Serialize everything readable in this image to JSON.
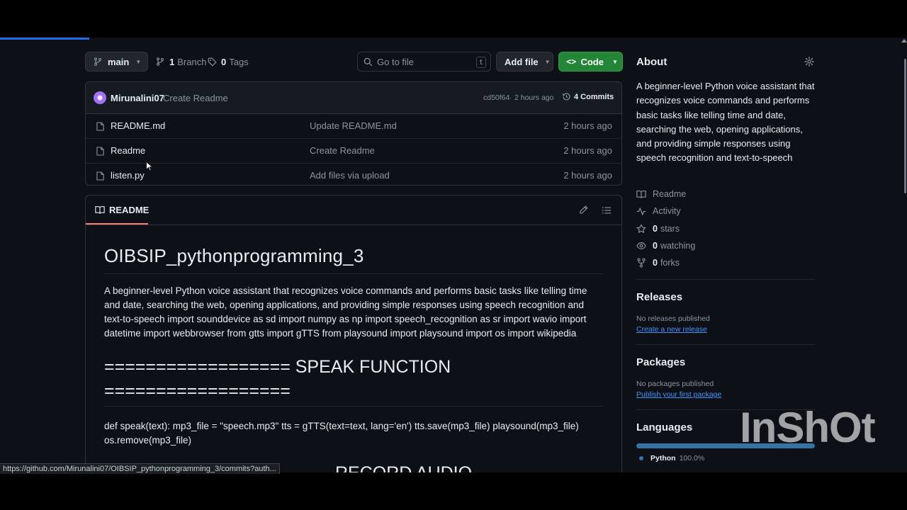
{
  "toolbar": {
    "branch_button": "main",
    "branches_count": "1",
    "branches_label": "Branch",
    "tags_count": "0",
    "tags_label": "Tags",
    "go_to_file_placeholder": "Go to file",
    "go_to_file_shortcut": "t",
    "add_file_label": "Add file",
    "code_label": "Code"
  },
  "latest_commit": {
    "author": "Mirunalini07",
    "message": "Create Readme",
    "hash": "cd50f64",
    "separator": "·",
    "time": "2 hours ago",
    "commits_count": "4 Commits"
  },
  "files": [
    {
      "name": "README.md",
      "message": "Update README.md",
      "time": "2 hours ago"
    },
    {
      "name": "Readme",
      "message": "Create Readme",
      "time": "2 hours ago"
    },
    {
      "name": "listen.py",
      "message": "Add files via upload",
      "time": "2 hours ago"
    }
  ],
  "readme": {
    "tab_label": "README",
    "title": "OIBSIP_pythonprogramming_3",
    "paragraph": "A beginner-level Python voice assistant that recognizes voice commands and performs basic tasks like telling time and date, searching the web, opening applications, and providing simple responses using speech recognition and text-to-speech import sounddevice as sd import numpy as np import speech_recognition as sr import wavio import datetime import webbrowser from gtts import gTTS from playsound import playsound import os import wikipedia",
    "heading_speak_line1": "================== SPEAK FUNCTION",
    "heading_speak_line2": "==================",
    "code_paragraph": "def speak(text): mp3_file = \"speech.mp3\" tts = gTTS(text=text, lang='en') tts.save(mp3_file) playsound(mp3_file) os.remove(mp3_file)",
    "heading_record_partial": "RECORD AUDIO"
  },
  "about": {
    "heading": "About",
    "description": "A beginner-level Python voice assistant that recognizes voice commands and performs basic tasks like telling time and date, searching the web, opening applications, and providing simple responses using speech recognition and text-to-speech",
    "readme_link": "Readme",
    "activity_link": "Activity",
    "stars_count": "0",
    "stars_label": "stars",
    "watching_count": "0",
    "watching_label": "watching",
    "forks_count": "0",
    "forks_label": "forks"
  },
  "releases": {
    "heading": "Releases",
    "empty_text": "No releases published",
    "create_link": "Create a new release"
  },
  "packages": {
    "heading": "Packages",
    "empty_text": "No packages published",
    "publish_link": "Publish your first package"
  },
  "languages": {
    "heading": "Languages",
    "items": [
      {
        "name": "Python",
        "percent": "100.0%",
        "color": "#3572A5"
      }
    ]
  },
  "status_bar_url": "https://github.com/Mirunalini07/OIBSIP_pythonprogramming_3/commits?auth...",
  "watermark": "InShOt",
  "colors": {
    "accent": "#1f6feb",
    "code_button": "#238636",
    "link": "#4493f8",
    "python": "#3572A5"
  }
}
